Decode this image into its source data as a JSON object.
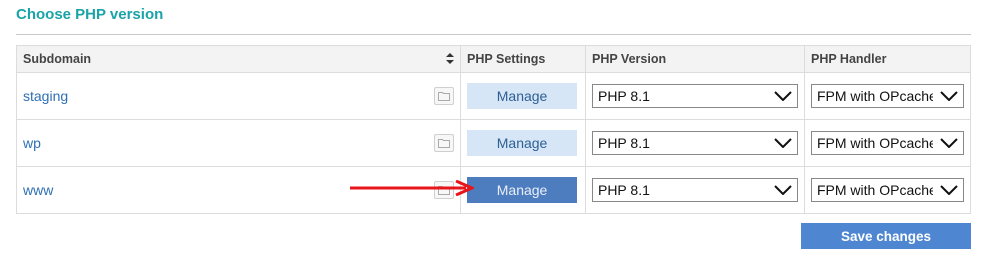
{
  "title": "Choose PHP version",
  "table": {
    "headers": {
      "subdomain": "Subdomain",
      "settings": "PHP Settings",
      "version": "PHP Version",
      "handler": "PHP Handler"
    },
    "rows": [
      {
        "subdomain": "staging",
        "manage_label": "Manage",
        "version": "PHP 8.1",
        "handler": "FPM with OPcache"
      },
      {
        "subdomain": "wp",
        "manage_label": "Manage",
        "version": "PHP 8.1",
        "handler": "FPM with OPcache"
      },
      {
        "subdomain": "www",
        "manage_label": "Manage",
        "version": "PHP 8.1",
        "handler": "FPM with OPcache"
      }
    ]
  },
  "save_label": "Save changes",
  "colors": {
    "title": "#1aa3a8",
    "link": "#2d6fb4",
    "manage_bg": "#d6e6f7",
    "manage_active_bg": "#4d7dbf",
    "save_bg": "#4f86d1",
    "arrow": "#e8161b"
  },
  "icons": [
    "sort-icon",
    "folder-icon",
    "chevron-down-icon",
    "red-arrow-icon"
  ]
}
